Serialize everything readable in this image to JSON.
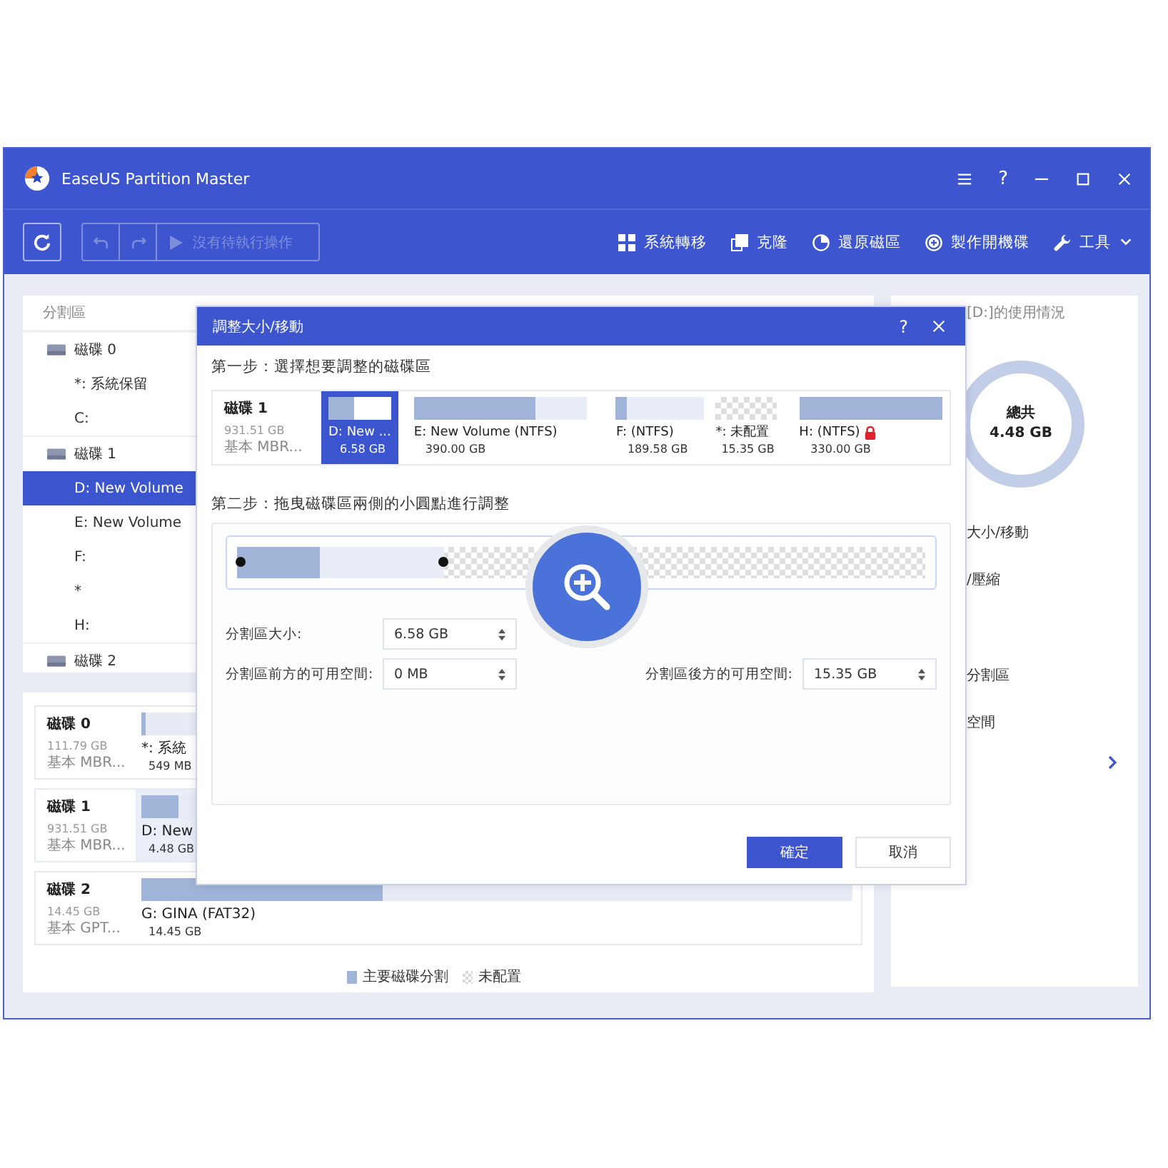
{
  "window": {
    "title": "EaseUS Partition Master",
    "help": "?"
  },
  "toolbar": {
    "pending_label": "沒有待執行操作",
    "pending_disabled": true,
    "tools": [
      {
        "label": "系統轉移",
        "kind": "windows",
        "dropdown": false
      },
      {
        "label": "克隆",
        "kind": "clone",
        "dropdown": false
      },
      {
        "label": "還原磁區",
        "kind": "pie",
        "dropdown": false
      },
      {
        "label": "製作開機碟",
        "kind": "plus",
        "dropdown": false
      },
      {
        "label": "工具",
        "kind": "wrench",
        "dropdown": true
      }
    ]
  },
  "partition_list": {
    "header": "分割區",
    "disks": [
      {
        "label": "磁碟 0",
        "selected": false,
        "children": [
          {
            "label": "*: 系統保留",
            "selected": false
          },
          {
            "label": "C:",
            "selected": false
          }
        ]
      },
      {
        "label": "磁碟 1",
        "selected": false,
        "children": [
          {
            "label": "D: New Volume",
            "selected": true
          },
          {
            "label": "E: New Volume",
            "selected": false
          },
          {
            "label": "F:",
            "selected": false
          },
          {
            "label": "*",
            "selected": false
          },
          {
            "label": "H:",
            "selected": false
          }
        ]
      },
      {
        "label": "磁碟 2",
        "selected": false
      }
    ]
  },
  "disk_map": {
    "disks": [
      {
        "name": "磁碟 0",
        "size": "111.79 GB",
        "type": "基本 MBR...",
        "partitions": [
          {
            "label": "*: 系統",
            "size": "549 MB",
            "level": 0.006,
            "selected": false
          }
        ]
      },
      {
        "name": "磁碟 1",
        "size": "931.51 GB",
        "type": "基本 MBR...",
        "partitions": [
          {
            "label": "D: New",
            "size": "4.48 GB",
            "level": 0.052,
            "selected": true
          }
        ]
      },
      {
        "name": "磁碟 2",
        "size": "14.45 GB",
        "type": "基本 GPT...",
        "partitions": [
          {
            "label": "G: GINA (FAT32)",
            "size": "14.45 GB",
            "level": 0.34,
            "selected": false
          }
        ]
      }
    ],
    "legend": [
      {
        "label": "主要磁碟分割",
        "kind": "primary"
      },
      {
        "label": "未配置",
        "kind": "unallocated"
      }
    ]
  },
  "side_panel": {
    "usage_title": "[D:]的使用情況",
    "usage": {
      "label": "總共",
      "total": "4.48 GB"
    },
    "action_groups": [
      [
        "大小/移動",
        "/壓縮"
      ],
      [
        "分割區",
        "空間"
      ]
    ]
  },
  "dialog": {
    "title": "調整大小/移動",
    "help": "?",
    "step1": "第一步：選擇想要調整的磁碟區",
    "disk": {
      "name": "磁碟 1",
      "size": "931.51 GB",
      "type": "基本 MBR..."
    },
    "partitions": [
      {
        "label": "D: New ...",
        "size": "6.58 GB",
        "kind": "partition",
        "level": 0.4,
        "selected": true,
        "locked": false
      },
      {
        "label": "E: New Volume (NTFS)",
        "size": "390.00 GB",
        "kind": "partition",
        "level": 0.7,
        "selected": false,
        "locked": false
      },
      {
        "label": "F: (NTFS)",
        "size": "189.58 GB",
        "kind": "partition",
        "level": 0.12,
        "selected": false,
        "locked": false
      },
      {
        "label": "*: 未配置",
        "size": "15.35 GB",
        "kind": "unallocated",
        "selected": false,
        "locked": false
      },
      {
        "label": "H: (NTFS)",
        "size": "330.00 GB",
        "kind": "partition",
        "level": 1,
        "selected": false,
        "locked": true
      }
    ],
    "step2": "第二步：拖曳磁碟區兩側的小圓點進行調整",
    "slider": {
      "level": 0.3,
      "used": {
        "level": 0.12
      }
    },
    "fields": [
      {
        "label": "分割區大小:",
        "value": "6.58 GB"
      },
      {
        "label": "分割區前方的可用空間:",
        "value": "0 MB"
      },
      {
        "label": "分割區後方的可用空間:",
        "value": "15.35 GB"
      }
    ],
    "buttons": [
      {
        "label": "確定",
        "primary": true
      },
      {
        "label": "取消",
        "primary": false
      }
    ]
  }
}
